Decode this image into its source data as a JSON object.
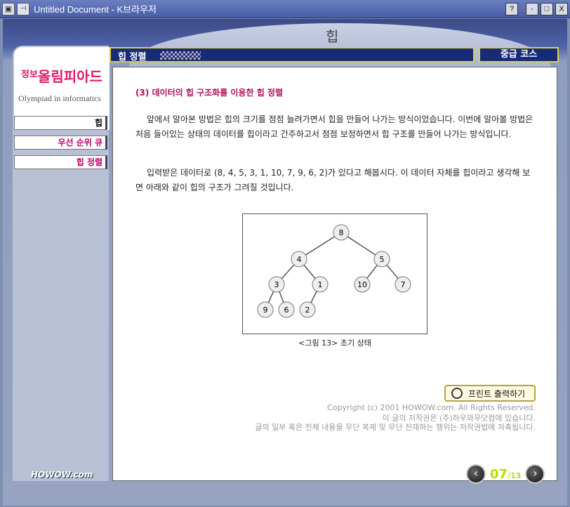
{
  "window": {
    "title": "Untitled Document - K브라우저",
    "help_label": "?",
    "minimize_label": "-",
    "maximize_label": "□",
    "close_label": "X"
  },
  "page": {
    "heading": "힙"
  },
  "logo": {
    "ko_prefix": "정보",
    "ko_main": "올림피아드",
    "en": "Olympiad in informatics"
  },
  "sidebar": {
    "items": [
      {
        "label": "힙"
      },
      {
        "label": "우선 순위 큐"
      },
      {
        "label": "힙 정렬"
      }
    ]
  },
  "section": {
    "title": "힙 정렬",
    "level": "중급 코스"
  },
  "content": {
    "heading": "(3) 데이터의 힙 구조화를 이용한 힙 정렬",
    "para1": "앞에서 알아본 방법은 힙의 크기를 점점 늘려가면서 힙을 만들어 나가는 방식이었습니다. 이번에 알아볼 방법은 처음 들어있는 상태의 데이터를 힙이라고 간주하고서 점점 보정하면서 힙 구조를 만들어 나가는 방식입니다.",
    "para2": "입력받은 데이터로 (8, 4, 5, 3, 1, 10, 7, 9, 6, 2)가 있다고 해봅시다. 이 데이터 자체를 힙이라고 생각해 보면 아래와 같이 힙의 구조가 그려질 것입니다.",
    "figure_caption": "<그림 13> 초기 상태",
    "tree_nodes": [
      "8",
      "4",
      "5",
      "3",
      "1",
      "10",
      "7",
      "9",
      "6",
      "2"
    ]
  },
  "footer": {
    "print_label": "프린트 출력하기",
    "copyright1": "Copyright (c) 2001 HOWOW.com. All Rights Reserved.",
    "copyright2": "이 글의 저작권은 (주)하우와우닷컴에 있습니다.",
    "copyright3": "글의 일부 혹은 전체 내용을 무단 복제 및 무단 전재하는 행위는 저작권법에 저촉됩니다.",
    "brand": "HOWOW.com",
    "page_current": "07",
    "page_total": "/13",
    "prev_label": "‹",
    "next_label": "›"
  },
  "colors": {
    "accent": "#c1006b",
    "navy": "#1a2a7a",
    "pager": "#b5e000"
  }
}
